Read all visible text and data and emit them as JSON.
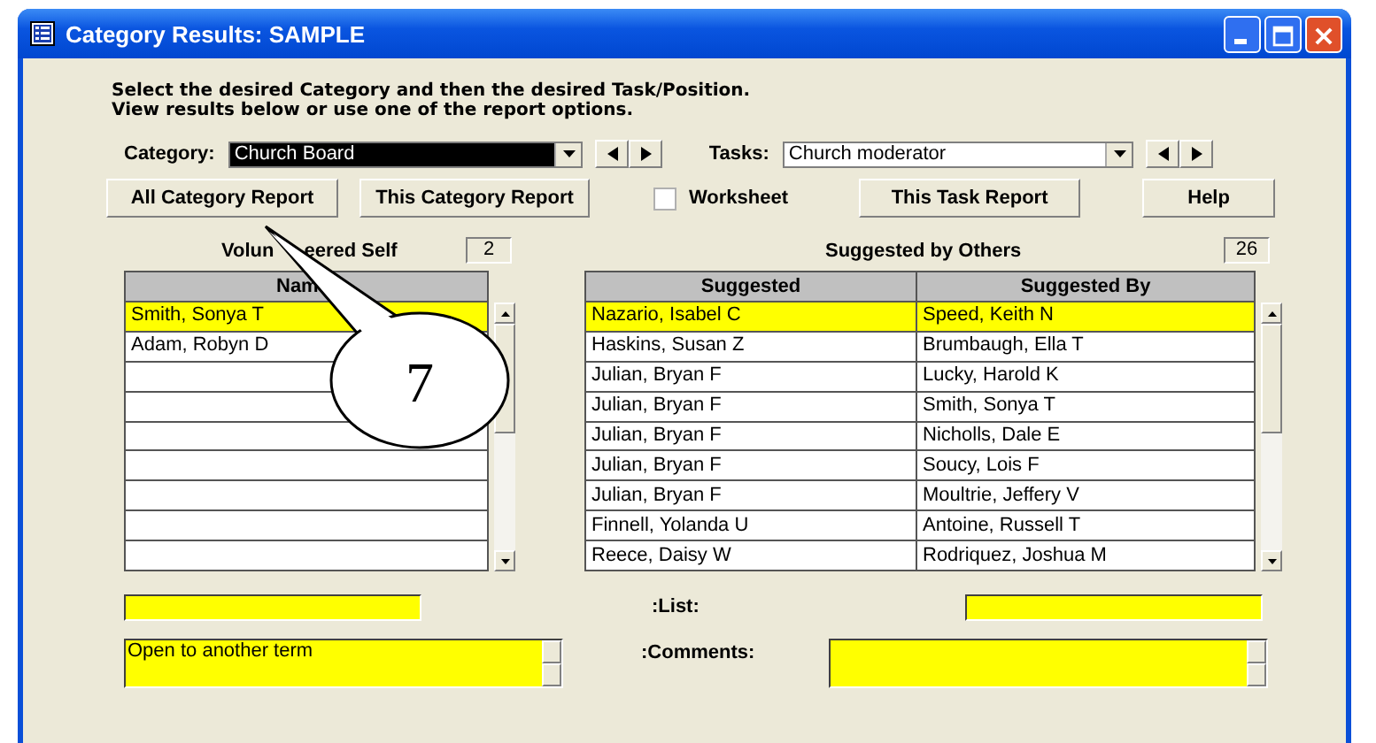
{
  "window": {
    "title": "Category Results: SAMPLE"
  },
  "instructions": [
    "Select the desired Category and then the desired Task/Position.",
    "View results below or use one of the report options."
  ],
  "category": {
    "label": "Category:",
    "value": "Church Board",
    "highlighted": true
  },
  "tasks": {
    "label": "Tasks:",
    "value": "Church moderator",
    "highlighted": false
  },
  "actions": [
    {
      "kind": "button",
      "label": "All Category Report"
    },
    {
      "kind": "button",
      "label": "This Category Report"
    },
    {
      "kind": "checkbox",
      "label": "Worksheet",
      "checked": false
    },
    {
      "kind": "button",
      "label": "This Task Report"
    },
    {
      "kind": "button",
      "label": "Help"
    }
  ],
  "volunteered": {
    "label_parts": [
      "Volun",
      "eered Self"
    ],
    "count": "2",
    "columns": [
      "Nam"
    ],
    "rows": [
      {
        "cells": [
          "Smith, Sonya T"
        ],
        "selected": true
      },
      {
        "cells": [
          "Adam, Robyn D"
        ],
        "selected": false
      }
    ]
  },
  "suggested": {
    "label": "Suggested by Others",
    "count": "26",
    "columns": [
      "Suggested",
      "Suggested By"
    ],
    "rows": [
      {
        "cells": [
          "Nazario, Isabel C",
          "Speed, Keith N"
        ],
        "selected": true
      },
      {
        "cells": [
          "Haskins, Susan Z",
          "Brumbaugh, Ella T"
        ],
        "selected": false
      },
      {
        "cells": [
          "Julian, Bryan F",
          "Lucky, Harold K"
        ],
        "selected": false
      },
      {
        "cells": [
          "Julian, Bryan F",
          "Smith, Sonya T"
        ],
        "selected": false
      },
      {
        "cells": [
          "Julian, Bryan F",
          "Nicholls, Dale E"
        ],
        "selected": false
      },
      {
        "cells": [
          "Julian, Bryan F",
          "Soucy, Lois F"
        ],
        "selected": false
      },
      {
        "cells": [
          "Julian, Bryan F",
          "Moultrie, Jeffery V"
        ],
        "selected": false
      },
      {
        "cells": [
          "Finnell, Yolanda U",
          "Antoine, Russell T"
        ],
        "selected": false
      },
      {
        "cells": [
          "Reece, Daisy W",
          "Rodriquez, Joshua M"
        ],
        "selected": false
      }
    ]
  },
  "list_label": ":List:",
  "comments_label": ":Comments:",
  "volunteer_comment": "Open to another term",
  "callout": {
    "number": "7"
  }
}
